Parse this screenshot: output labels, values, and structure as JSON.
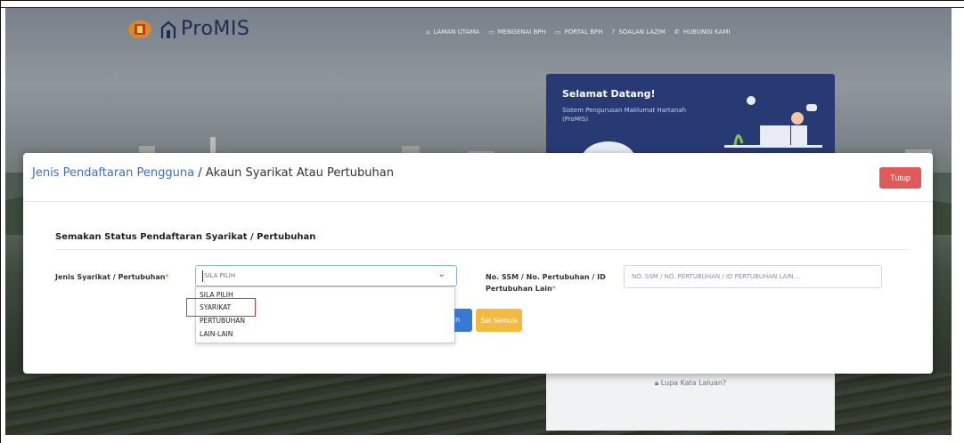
{
  "brand": {
    "name": "ProMIS"
  },
  "nav": [
    {
      "icon": "⌂",
      "label": "LAMAN UTAMA"
    },
    {
      "icon": "▭",
      "label": "MENGENAI BPH"
    },
    {
      "icon": "▭",
      "label": "PORTAL BPH"
    },
    {
      "icon": "?",
      "label": "SOALAN LAZIM"
    },
    {
      "icon": "✆",
      "label": "HUBUNGI KAMI"
    }
  ],
  "welcome": {
    "title": "Selamat Datang!",
    "subtitle": "Sistem Pengurusan Maklumat Hartanah (ProMIS)"
  },
  "forgot_password": "Lupa Kata Laluan?",
  "modal": {
    "breadcrumb_link": "Jenis Pendaftaran Pengguna",
    "breadcrumb_sep": " / ",
    "breadcrumb_current": "Akaun Syarikat Atau Pertubuhan",
    "close_label": "Tutup",
    "section_title": "Semakan Status Pendaftaran Syarikat / Pertubuhan",
    "type_label": "Jenis Syarikat / Pertubuhan",
    "type_selected": "SILA PILIH",
    "type_options": [
      "SILA PILIH",
      "SYARIKAT",
      "PERTUBUHAN",
      "LAIN-LAIN"
    ],
    "reg_label_line1": "No. SSM / No. Pertubuhan / ID",
    "reg_label_line2": "Pertubuhan Lain",
    "reg_placeholder": "NO. SSM / NO. PERTUBUHAN / ID PERTUBUHAN LAIN...",
    "search_label_partial": "n",
    "reset_label": "Set Semula",
    "required_mark": "*"
  },
  "colors": {
    "brand_navy": "#1d2b57",
    "link_blue": "#3c6fc4",
    "close_red": "#e05a5a",
    "reset_yellow": "#f3b941",
    "search_blue": "#3a78d6",
    "highlight_red": "#d23a3a"
  }
}
